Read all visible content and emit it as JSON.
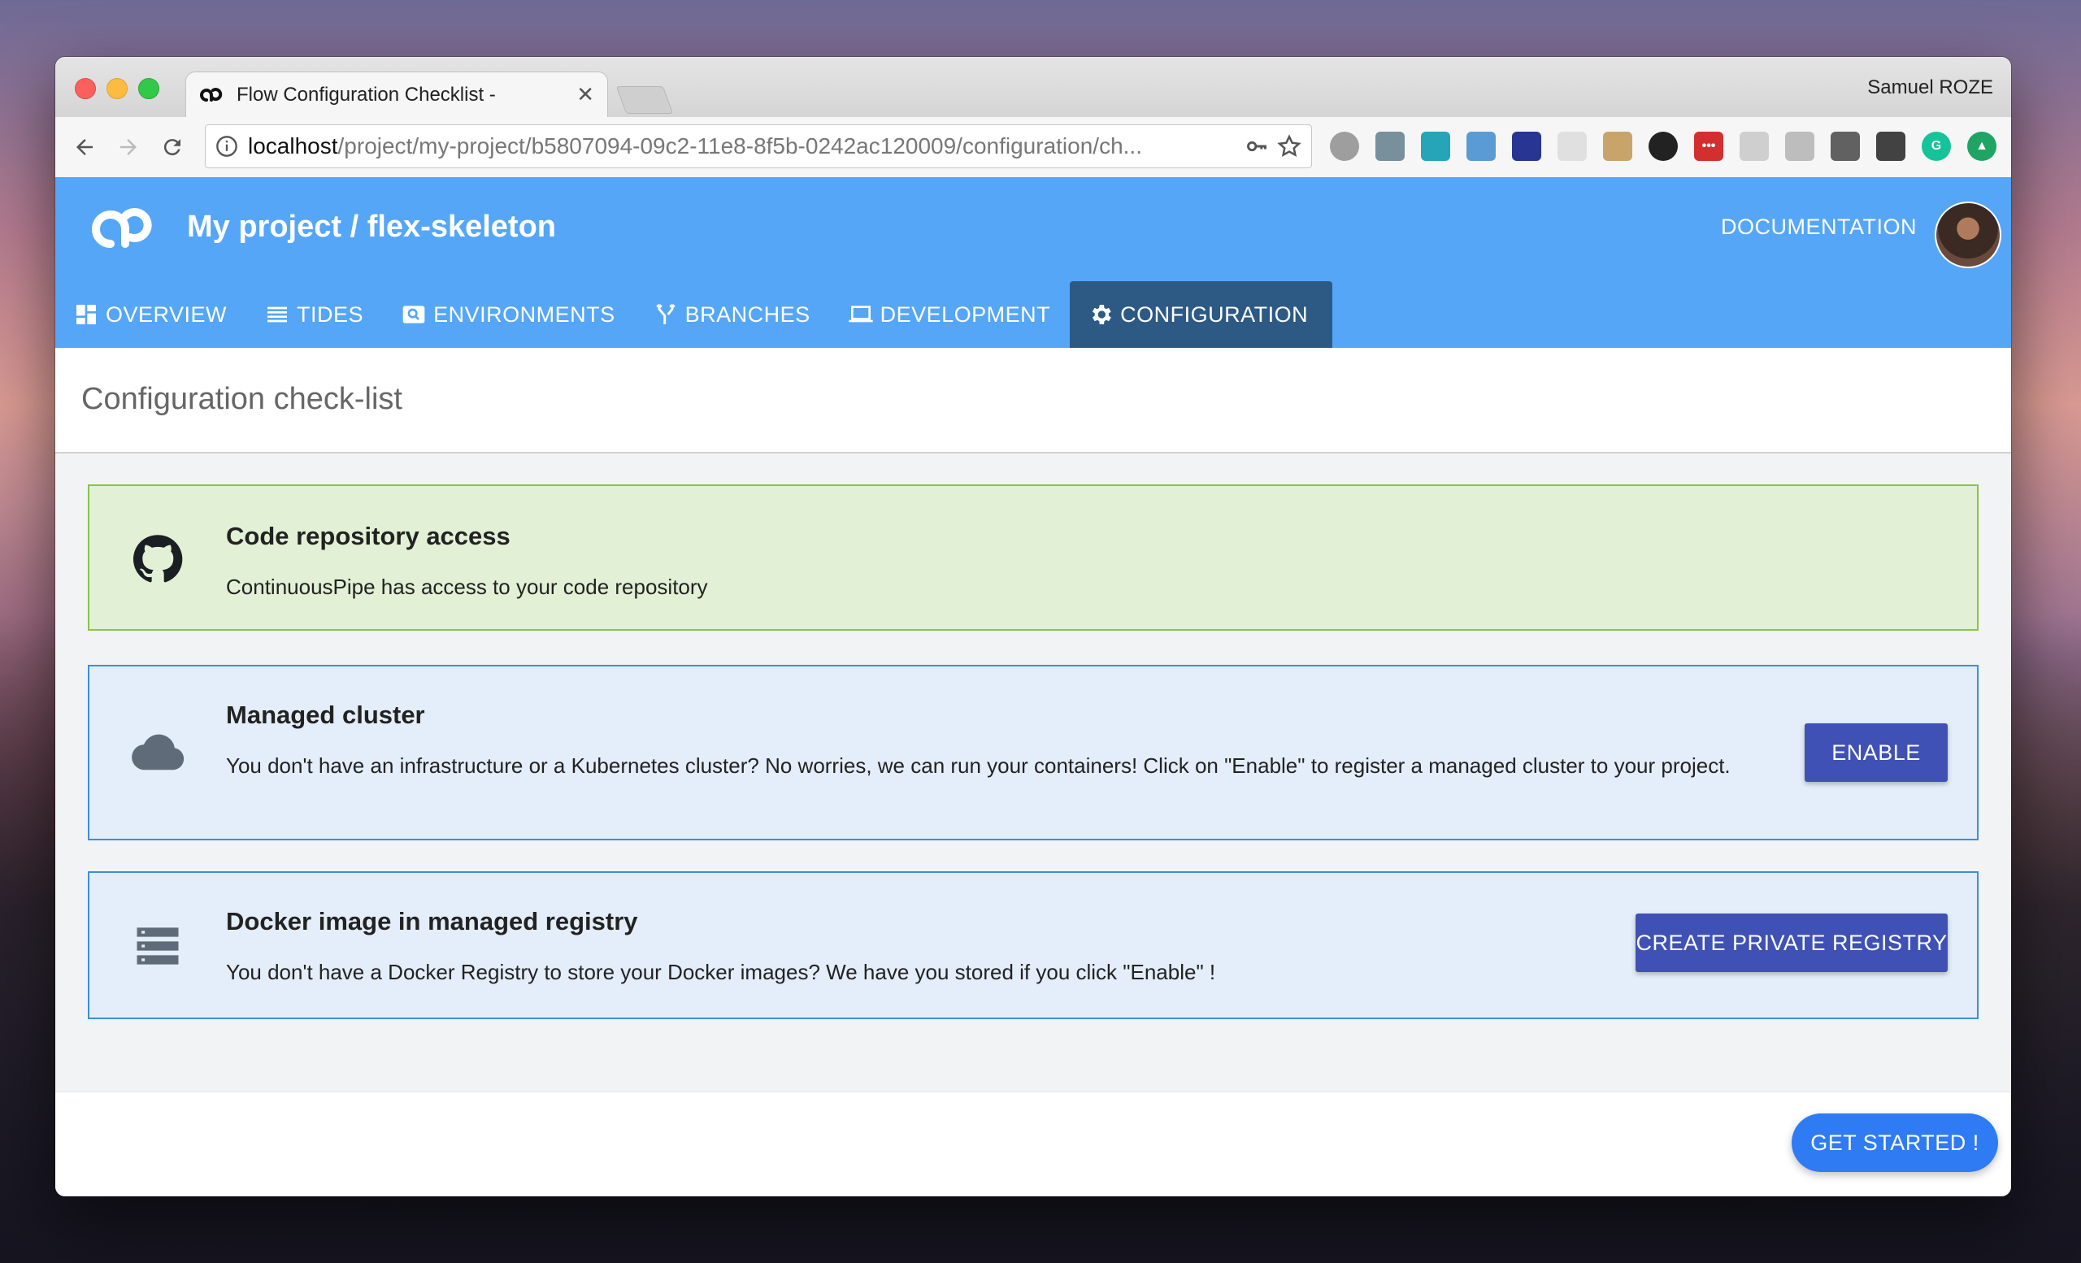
{
  "browser": {
    "tab_title": "Flow Configuration Checklist -",
    "profile_name": "Samuel ROZE",
    "url_host": "localhost",
    "url_path": "/project/my-project/b5807094-09c2-11e8-8f5b-0242ac120009/configuration/ch..."
  },
  "header": {
    "title": "My project / flex-skeleton",
    "documentation_label": "DOCUMENTATION"
  },
  "nav": {
    "overview": "OVERVIEW",
    "tides": "TIDES",
    "environments": "ENVIRONMENTS",
    "branches": "BRANCHES",
    "development": "DEVELOPMENT",
    "configuration": "CONFIGURATION"
  },
  "page": {
    "title": "Configuration check-list"
  },
  "checklist": [
    {
      "title": "Code repository access",
      "text": "ContinuousPipe has access to your code repository",
      "status": "complete"
    },
    {
      "title": "Managed cluster",
      "text": "You don't have an infrastructure or a Kubernetes cluster? No worries, we can run your containers! Click on \"Enable\" to register a managed cluster to your project.",
      "button": "ENABLE"
    },
    {
      "title": "Docker image in managed registry",
      "text": "You don't have a Docker Registry to store your Docker images? We have you stored if you click \"Enable\" !",
      "button": "CREATE PRIVATE REGISTRY"
    }
  ],
  "footer": {
    "cta": "GET STARTED !"
  },
  "colors": {
    "header_blue": "#55a6f6",
    "active_tab": "#2d5985",
    "button_indigo": "#3f51b5",
    "success_green": "#8bc34a",
    "info_blue": "#3d8fd6",
    "fab_blue": "#2f7bf3"
  }
}
